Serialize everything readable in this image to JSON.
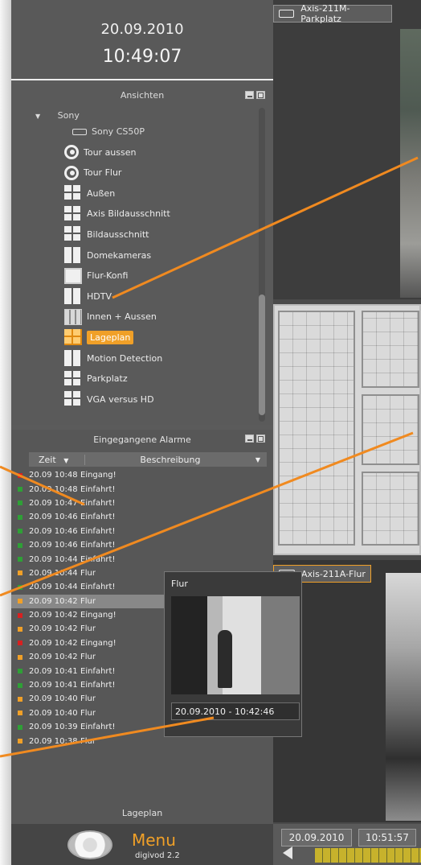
{
  "clock": {
    "date": "20.09.2010",
    "time": "10:49:07"
  },
  "views": {
    "title": "Ansichten",
    "group": "Sony",
    "camera": "Sony CS50P",
    "items": [
      {
        "label": "Tour aussen",
        "icon": "tour-icon"
      },
      {
        "label": "Tour Flur",
        "icon": "tour-icon"
      },
      {
        "label": "Außen",
        "icon": "grid-4-icon"
      },
      {
        "label": "Axis Bildausschnitt",
        "icon": "grid-4-icon"
      },
      {
        "label": "Bildausschnitt",
        "icon": "grid-4-icon"
      },
      {
        "label": "Domekameras",
        "icon": "split-icon"
      },
      {
        "label": "Flur-Konfi",
        "icon": "single-icon"
      },
      {
        "label": "HDTV",
        "icon": "split-icon"
      },
      {
        "label": "Innen + Aussen",
        "icon": "grid-9-icon"
      },
      {
        "label": "Lageplan",
        "icon": "grid-4-icon",
        "selected": true
      },
      {
        "label": "Motion Detection",
        "icon": "split-icon"
      },
      {
        "label": "Parkplatz",
        "icon": "grid-4-icon"
      },
      {
        "label": "VGA versus HD",
        "icon": "grid-4-icon"
      }
    ]
  },
  "alarms": {
    "title": "Eingegangene Alarme",
    "col_time": "Zeit",
    "col_desc": "Beschreibung",
    "rows": [
      {
        "time": "20.09 10:48",
        "text": "Eingang!",
        "color": "#d82020"
      },
      {
        "time": "20.09 10:48",
        "text": "Einfahrt!",
        "color": "#2ea036"
      },
      {
        "time": "20.09 10:47",
        "text": "Einfahrt!",
        "color": "#2ea036"
      },
      {
        "time": "20.09 10:46",
        "text": "Einfahrt!",
        "color": "#2ea036"
      },
      {
        "time": "20.09 10:46",
        "text": "Einfahrt!",
        "color": "#2ea036"
      },
      {
        "time": "20.09 10:46",
        "text": "Einfahrt!",
        "color": "#2ea036"
      },
      {
        "time": "20.09 10:44",
        "text": "Einfahrt!",
        "color": "#2ea036"
      },
      {
        "time": "20.09 10:44",
        "text": "Flur",
        "color": "#f0a028"
      },
      {
        "time": "20.09 10:44",
        "text": "Einfahrt!",
        "color": "#2ea036"
      },
      {
        "time": "20.09 10:42",
        "text": "Flur",
        "color": "#f0a028",
        "selected": true
      },
      {
        "time": "20.09 10:42",
        "text": "Eingang!",
        "color": "#d82020"
      },
      {
        "time": "20.09 10:42",
        "text": "Flur",
        "color": "#f0a028"
      },
      {
        "time": "20.09 10:42",
        "text": "Eingang!",
        "color": "#d82020"
      },
      {
        "time": "20.09 10:42",
        "text": "Flur",
        "color": "#f0a028"
      },
      {
        "time": "20.09 10:41",
        "text": "Einfahrt!",
        "color": "#2ea036"
      },
      {
        "time": "20.09 10:41",
        "text": "Einfahrt!",
        "color": "#2ea036"
      },
      {
        "time": "20.09 10:40",
        "text": "Flur",
        "color": "#f0a028"
      },
      {
        "time": "20.09 10:40",
        "text": "Flur",
        "color": "#f0a028"
      },
      {
        "time": "20.09 10:39",
        "text": "Einfahrt!",
        "color": "#2ea036"
      },
      {
        "time": "20.09 10:38",
        "text": "Flur",
        "color": "#f0a028"
      }
    ],
    "footer": "Lageplan"
  },
  "menu": {
    "label": "Menu",
    "version": "digivod 2.2"
  },
  "cameras": {
    "top": "Axis-211M-Parkplatz",
    "bottom": "Axis-211A-Flur"
  },
  "popup": {
    "title": "Flur",
    "timestamp": "20.09.2010 - 10:42:46"
  },
  "timebar": {
    "date": "20.09.2010",
    "time": "10:51:57"
  },
  "colors": {
    "accent": "#f0a028",
    "panel": "#5a5a5a"
  }
}
